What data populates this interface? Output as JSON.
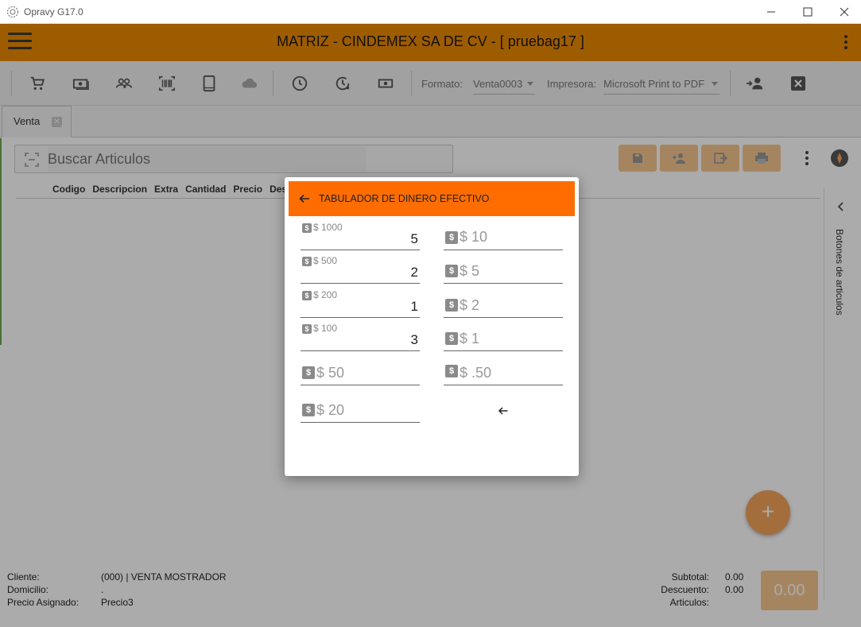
{
  "window": {
    "title": "Opravy G17.0"
  },
  "header": {
    "title": "MATRIZ - CINDEMEX SA DE CV - [ pruebag17 ]"
  },
  "toolbar": {
    "formato_label": "Formato:",
    "formato_value": "Venta0003",
    "impresora_label": "Impresora:",
    "impresora_value": "Microsoft Print to PDF"
  },
  "tabs": [
    {
      "label": "Venta"
    }
  ],
  "search": {
    "placeholder": "Buscar Articulos"
  },
  "table": {
    "columns": [
      "Codigo",
      "Descripcion",
      "Extra",
      "Cantidad",
      "Precio",
      "Des"
    ]
  },
  "side_panel": {
    "label": "Botones de articulos"
  },
  "footer": {
    "cliente_label": "Cliente:",
    "cliente_value": "(000) | VENTA MOSTRADOR",
    "domicilio_label": "Domicilio:",
    "domicilio_value": ".",
    "precio_label": "Precio Asignado:",
    "precio_value": "Precio3",
    "subtotal_label": "Subtotal:",
    "subtotal_value": "0.00",
    "descuento_label": "Descuento:",
    "descuento_value": "0.00",
    "articulos_label": "Articulos:",
    "articulos_value": "",
    "total": "0.00"
  },
  "dialog": {
    "title": "TABULADOR DE DINERO EFECTIVO",
    "badge": "$",
    "denominations_left": [
      {
        "label": "$ 1000",
        "value": "5"
      },
      {
        "label": "$ 500",
        "value": "2"
      },
      {
        "label": "$ 200",
        "value": "1"
      },
      {
        "label": "$ 100",
        "value": "3"
      },
      {
        "label": "$ 50",
        "value": ""
      },
      {
        "label": "$ 20",
        "value": ""
      }
    ],
    "denominations_right": [
      {
        "label": "$ 10",
        "value": ""
      },
      {
        "label": "$ 5",
        "value": ""
      },
      {
        "label": "$ 2",
        "value": ""
      },
      {
        "label": "$ 1",
        "value": ""
      },
      {
        "label": "$ .50",
        "value": ""
      }
    ]
  },
  "colors": {
    "header": "#ec8a00",
    "dialog_header": "#ff6d00",
    "action": "#f7c690"
  }
}
